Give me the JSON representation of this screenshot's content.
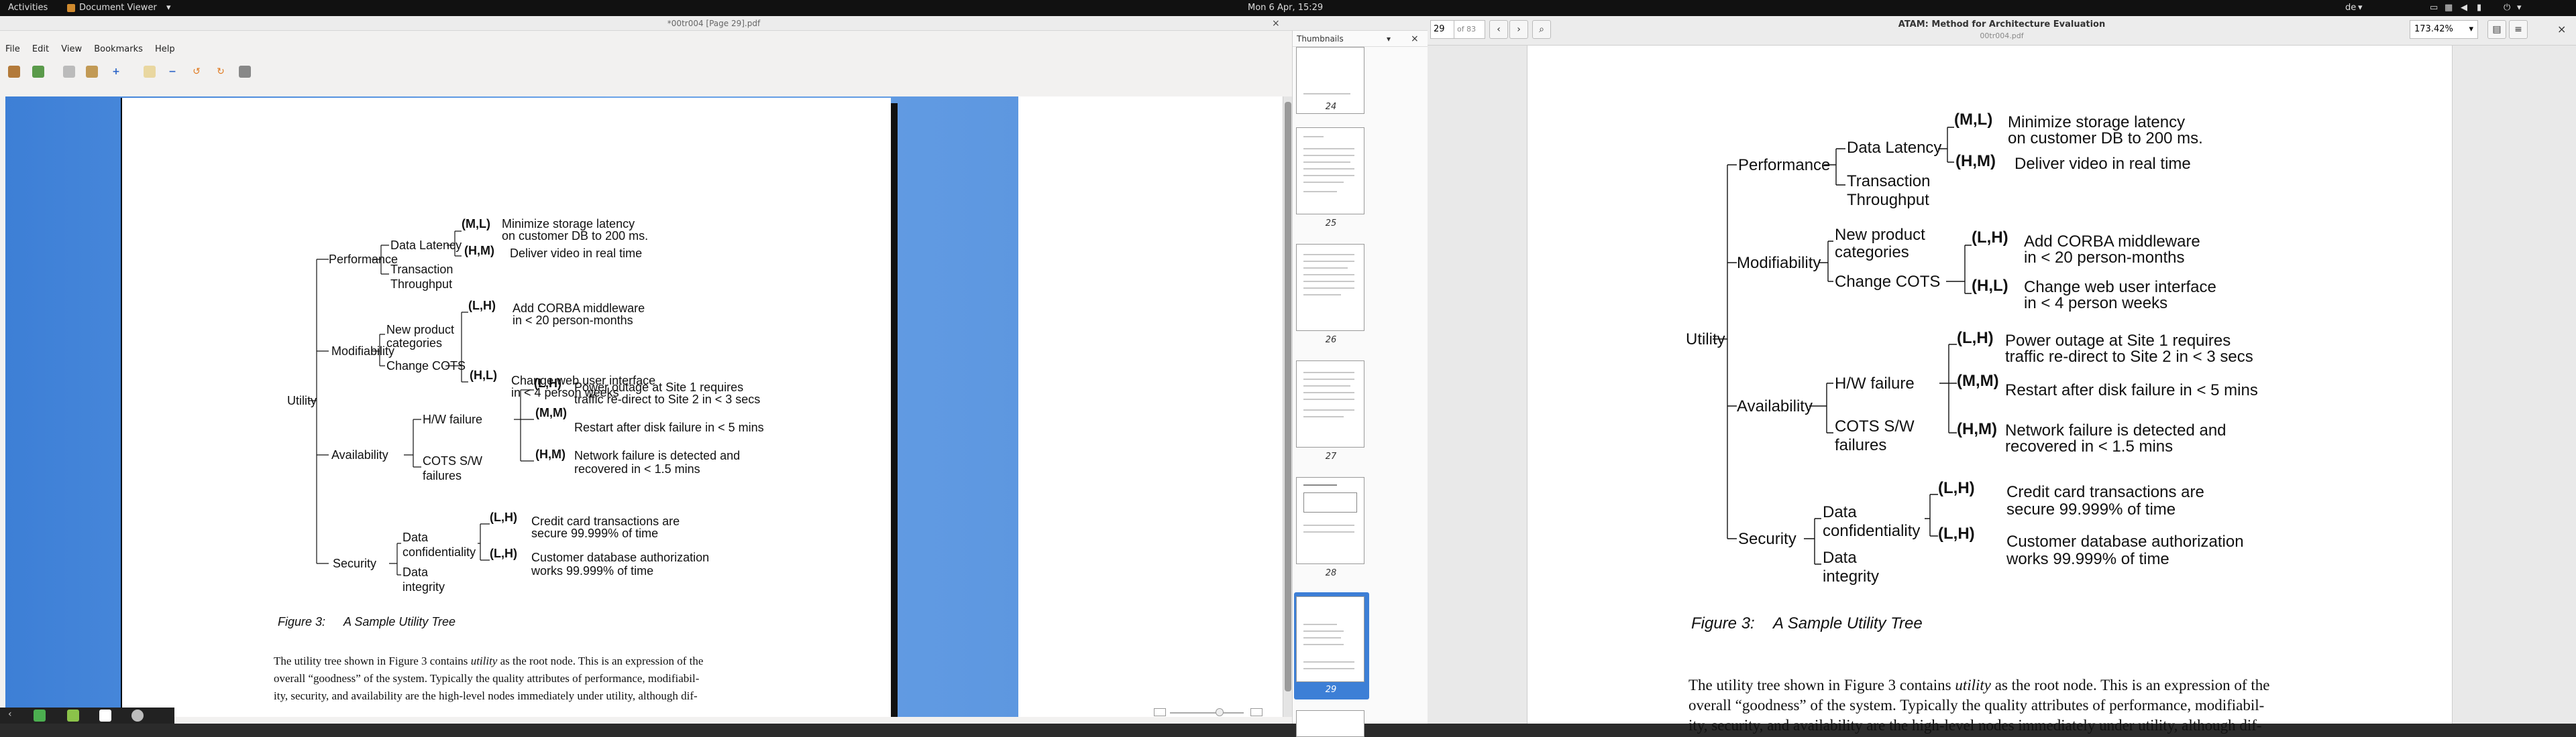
{
  "system": {
    "activities": "Activities",
    "app_name": "Document Viewer",
    "clock": "Mon  6 Apr, 15:29",
    "keyboard_layout": "de"
  },
  "left_window": {
    "title": "*00tr004 [Page 29].pdf",
    "menu": [
      "File",
      "Edit",
      "View",
      "Bookmarks",
      "Help"
    ],
    "thumbnails_label": "Thumbnails",
    "thumb_pages": [
      "24",
      "25",
      "26",
      "27",
      "28",
      "29"
    ],
    "selected_page": "29"
  },
  "right_window": {
    "page_input": "29",
    "page_of": "of 83",
    "title": "ATAM: Method for Architecture Evaluation",
    "subtitle": "00tr004.pdf",
    "zoom": "173.42%"
  },
  "document": {
    "tree": {
      "root": "Utility",
      "performance": "Performance",
      "data_latency": "Data Latency",
      "transaction_throughput_1": "Transaction",
      "transaction_throughput_2": "Throughput",
      "modifiability": "Modifiability",
      "new_product_1": "New product",
      "new_product_2": "categories",
      "change_cots": "Change COTS",
      "availability": "Availability",
      "hw_failure": "H/W failure",
      "cots_sw_1": "COTS S/W",
      "cots_sw_2": "failures",
      "security": "Security",
      "data_conf_1": "Data",
      "data_conf_2": "confidentiality",
      "data_integ_1": "Data",
      "data_integ_2": "integrity"
    },
    "scenarios": {
      "s1_tag": "(M,L)",
      "s1_a": "Minimize storage latency",
      "s1_b": "on customer DB to 200 ms.",
      "s2_tag": "(H,M)",
      "s2_a": "Deliver video in real time",
      "s3_tag": "(L,H)",
      "s3_a": "Add CORBA middleware",
      "s3_b": "in < 20 person-months",
      "s4_tag": "(H,L)",
      "s4_a": "Change web user interface",
      "s4_b": "in < 4 person weeks",
      "s5_tag": "(L,H)",
      "s5_a": "Power outage at Site 1 requires",
      "s5_b": "traffic re-direct to Site 2 in < 3 secs",
      "s6_tag": "(M,M)",
      "s6_a": "Restart after disk failure in < 5 mins",
      "s7_tag": "(H,M)",
      "s7_a": "Network failure is detected and",
      "s7_b": "recovered in < 1.5 mins",
      "s8_tag": "(L,H)",
      "s8_a": "Credit card transactions are",
      "s8_b": "secure 99.999% of time",
      "s9_tag": "(L,H)",
      "s9_a": "Customer database authorization",
      "s9_b": "works 99.999% of time"
    },
    "caption_num": "Figure 3:",
    "caption_text": "A Sample Utility Tree",
    "para_1a": "The utility tree shown in Figure 3 contains ",
    "para_1_em": "utility",
    "para_1b": " as the root node. This is an expression of the",
    "para_2": "overall “goodness” of the system. Typically the quality attributes of performance, modifiabil-",
    "para_3": "ity, security, and availability are the high-level nodes immediately under utility, although dif-"
  }
}
